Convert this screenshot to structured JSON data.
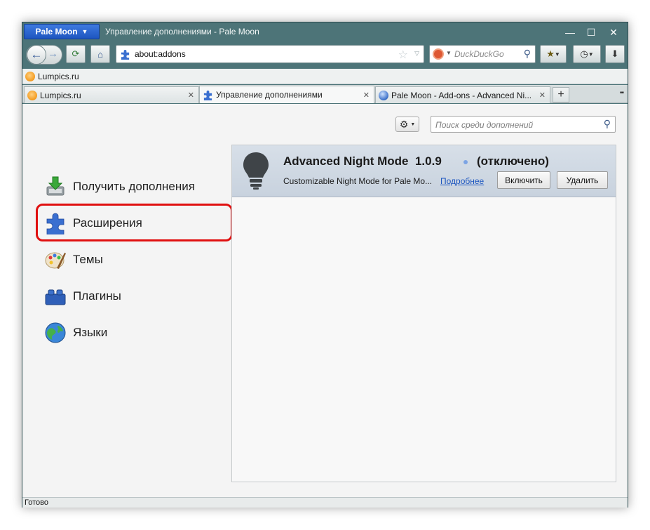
{
  "window": {
    "menu_label": "Pale Moon",
    "title": "Управление дополнениями - Pale Moon",
    "minimize": "—",
    "maximize": "☐",
    "close": "✕"
  },
  "navbar": {
    "url": "about:addons",
    "search_engine": "DuckDuckGo"
  },
  "bookmarks": [
    {
      "label": "Lumpics.ru"
    }
  ],
  "tabs": [
    {
      "label": "Lumpics.ru",
      "active": false
    },
    {
      "label": "Управление дополнениями",
      "active": true
    },
    {
      "label": "Pale Moon - Add-ons - Advanced Ni...",
      "active": false
    }
  ],
  "addons_page": {
    "search_placeholder": "Поиск среди дополнений",
    "categories": [
      {
        "label": "Получить дополнения",
        "icon": "download-addons-icon"
      },
      {
        "label": "Расширения",
        "icon": "puzzle-piece-icon",
        "selected": true
      },
      {
        "label": "Темы",
        "icon": "palette-icon"
      },
      {
        "label": "Плагины",
        "icon": "lego-brick-icon"
      },
      {
        "label": "Языки",
        "icon": "globe-icon"
      }
    ],
    "addon": {
      "name": "Advanced Night Mode",
      "version": "1.0.9",
      "status": "(отключено)",
      "description": "Customizable Night Mode for Pale Mo...",
      "more_link": "Подробнее",
      "enable_label": "Включить",
      "remove_label": "Удалить"
    }
  },
  "statusbar": {
    "text": "Готово"
  },
  "colors": {
    "frame": "#4d7478",
    "menu_button": "#1d55c0",
    "highlight": "#e01010",
    "addon_row": "#d7dfe8",
    "link": "#1c56c0"
  }
}
